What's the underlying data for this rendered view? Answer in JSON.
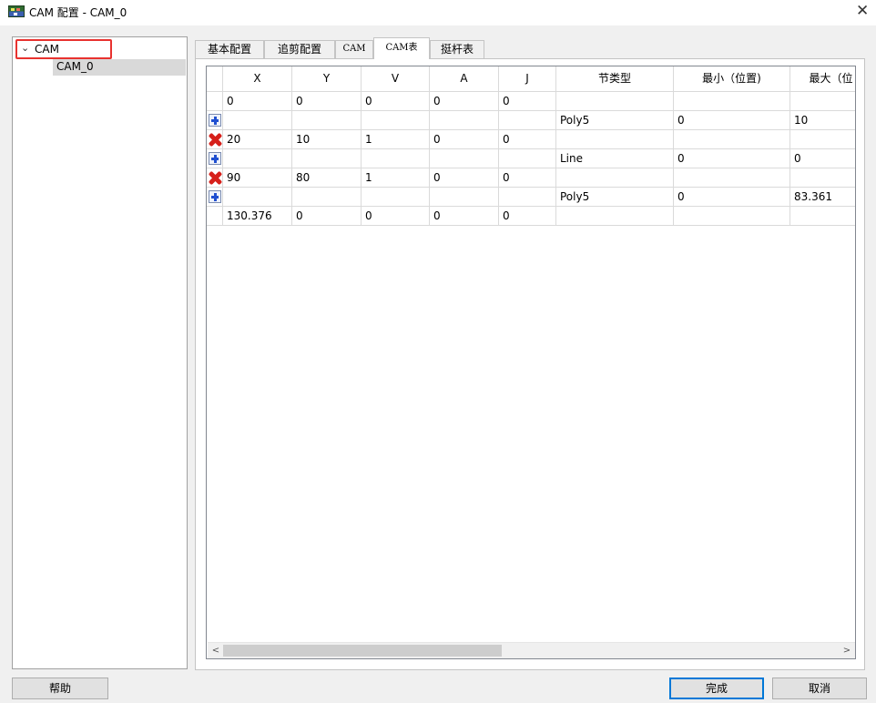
{
  "window": {
    "title": "CAM 配置 - CAM_0",
    "close_glyph": "✕"
  },
  "tree": {
    "root_label": "CAM",
    "child_label": "CAM_0",
    "chevron": "⌄"
  },
  "tabs": [
    {
      "label": "基本配置",
      "active": false
    },
    {
      "label": "追剪配置",
      "active": false
    },
    {
      "label": "CAM",
      "active": false
    },
    {
      "label": "CAM表",
      "active": true
    },
    {
      "label": "挺杆表",
      "active": false
    }
  ],
  "table": {
    "headers": [
      "X",
      "Y",
      "V",
      "A",
      "J",
      "节类型",
      "最小（位置)",
      "最大（位"
    ],
    "rows": [
      {
        "icon": "none",
        "cells": [
          "0",
          "0",
          "0",
          "0",
          "0",
          "",
          "",
          ""
        ]
      },
      {
        "icon": "add-icon",
        "cells": [
          "",
          "",
          "",
          "",
          "",
          "Poly5",
          "0",
          "10"
        ]
      },
      {
        "icon": "delete-icon",
        "cells": [
          "20",
          "10",
          "1",
          "0",
          "0",
          "",
          "",
          ""
        ]
      },
      {
        "icon": "add-icon",
        "cells": [
          "",
          "",
          "",
          "",
          "",
          "Line",
          "0",
          "0"
        ]
      },
      {
        "icon": "delete-icon",
        "cells": [
          "90",
          "80",
          "1",
          "0",
          "0",
          "",
          "",
          ""
        ]
      },
      {
        "icon": "add-icon",
        "cells": [
          "",
          "",
          "",
          "",
          "",
          "Poly5",
          "0",
          "83.361"
        ]
      },
      {
        "icon": "none",
        "cells": [
          "130.376",
          "0",
          "0",
          "0",
          "0",
          "",
          "",
          ""
        ]
      }
    ]
  },
  "scrollbar": {
    "left_arrow": "<",
    "right_arrow": ">"
  },
  "buttons": {
    "help": "帮助",
    "done": "完成",
    "cancel": "取消"
  },
  "colors": {
    "highlight_border": "#e8322f",
    "add_icon": "#1f4fd0",
    "delete_icon": "#d6201a",
    "default_button": "#0078d7"
  }
}
